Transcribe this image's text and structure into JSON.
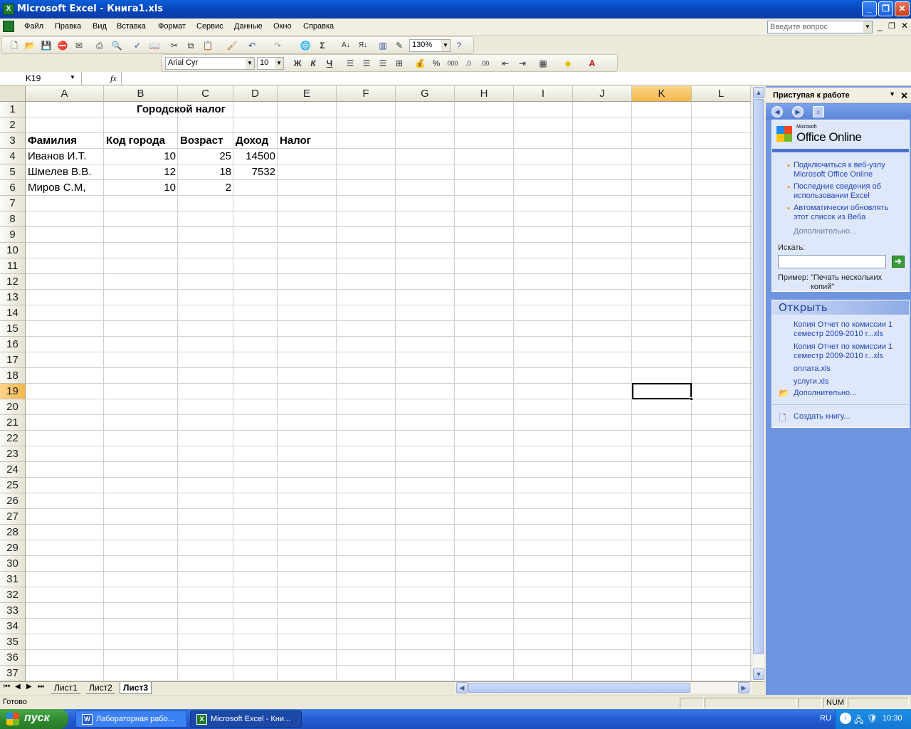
{
  "window": {
    "title": "Microsoft Excel - Книга1.xls",
    "app_icon": "X"
  },
  "menu": {
    "items": [
      "Файл",
      "Правка",
      "Вид",
      "Вставка",
      "Формат",
      "Сервис",
      "Данные",
      "Окно",
      "Справка"
    ],
    "ask_placeholder": "Введите вопрос"
  },
  "toolbar": {
    "zoom": "130%",
    "font": "Arial Cyr",
    "size": "10",
    "bold": "Ж",
    "italic": "К",
    "underline": "Ч",
    "currency": "%",
    "thousands": "000"
  },
  "formula": {
    "name_box": "K19",
    "fx": "fx",
    "content": ""
  },
  "sheet": {
    "columns": [
      "A",
      "B",
      "C",
      "D",
      "E",
      "F",
      "G",
      "H",
      "I",
      "J",
      "K",
      "L"
    ],
    "rows": [
      "1",
      "2",
      "3",
      "4",
      "5",
      "6",
      "7",
      "8",
      "9",
      "10",
      "11",
      "12",
      "13",
      "14",
      "15",
      "16",
      "17",
      "18",
      "19",
      "20",
      "21",
      "22",
      "23",
      "24",
      "25",
      "26",
      "27",
      "28",
      "29",
      "30",
      "31",
      "32",
      "33",
      "34",
      "35",
      "36",
      "37"
    ],
    "selected_col": "K",
    "selected_row": "19",
    "title": "Городской налог",
    "headers": [
      "Фамилия",
      "Код города",
      "Возраст",
      "Доход",
      "Налог"
    ],
    "data": [
      [
        "Иванов И.Т.",
        "10",
        "25",
        "14500"
      ],
      [
        "Шмелев В.В.",
        "12",
        "18",
        "7532"
      ],
      [
        "Миров С.М,",
        "10",
        "2",
        ""
      ]
    ]
  },
  "tabs": {
    "sheets": [
      "Лист1",
      "Лист2",
      "Лист3"
    ],
    "active": "Лист3"
  },
  "pane": {
    "header": "Приступая к работе",
    "logo_small": "Microsoft",
    "logo_big": "Office Online",
    "links": [
      "Подключиться к веб-узлу Microsoft Office Online",
      "Последние сведения об использовании Excel",
      "Автоматически обновлять этот список из Веба"
    ],
    "more": "Дополнительно...",
    "search_label": "Искать:",
    "example_label": "Пример:",
    "example_text": "\"Печать нескольких копий\"",
    "open_header": "Открыть",
    "files": [
      "Копия Отчет по комиссии  1 семестр 2009-2010 г...xls",
      "Копия Отчет по комиссии  1 семестр 2009-2010 г...xls",
      "оплата.xls",
      "услуги.xls"
    ],
    "open_more": "Дополнительно...",
    "create": "Создать книгу..."
  },
  "status": {
    "ready": "Готово",
    "num": "NUM"
  },
  "taskbar": {
    "start": "пуск",
    "tasks": [
      "Лабораторная рабо...",
      "Microsoft Excel - Кни..."
    ],
    "lang": "RU",
    "time": "10:30"
  }
}
